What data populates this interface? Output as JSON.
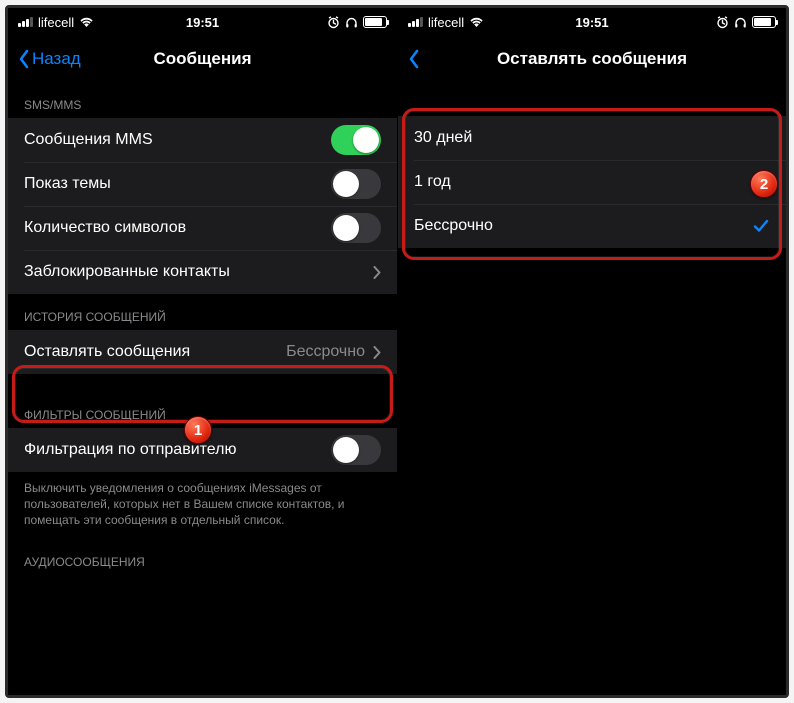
{
  "status": {
    "carrier": "lifecell",
    "time": "19:51"
  },
  "left_screen": {
    "back_label": "Назад",
    "title": "Сообщения",
    "section_sms": "SMS/MMS",
    "rows": {
      "mms": "Сообщения MMS",
      "subject": "Показ темы",
      "charcount": "Количество символов",
      "blocked": "Заблокированные контакты"
    },
    "section_history": "ИСТОРИЯ СООБЩЕНИЙ",
    "keep_label": "Оставлять сообщения",
    "keep_value": "Бессрочно",
    "section_filters": "ФИЛЬТРЫ СООБЩЕНИЙ",
    "filter_label": "Фильтрация по отправителю",
    "filter_footer": "Выключить уведомления о сообщениях iMessages от пользователей, которых нет в Вашем списке контактов, и помещать эти сообщения в отдельный список.",
    "section_audio": "АУДИОСООБЩЕНИЯ"
  },
  "right_screen": {
    "title": "Оставлять сообщения",
    "options": {
      "opt30": "30 дней",
      "opt1y": "1 год",
      "forever": "Бессрочно"
    }
  },
  "badges": {
    "one": "1",
    "two": "2"
  }
}
